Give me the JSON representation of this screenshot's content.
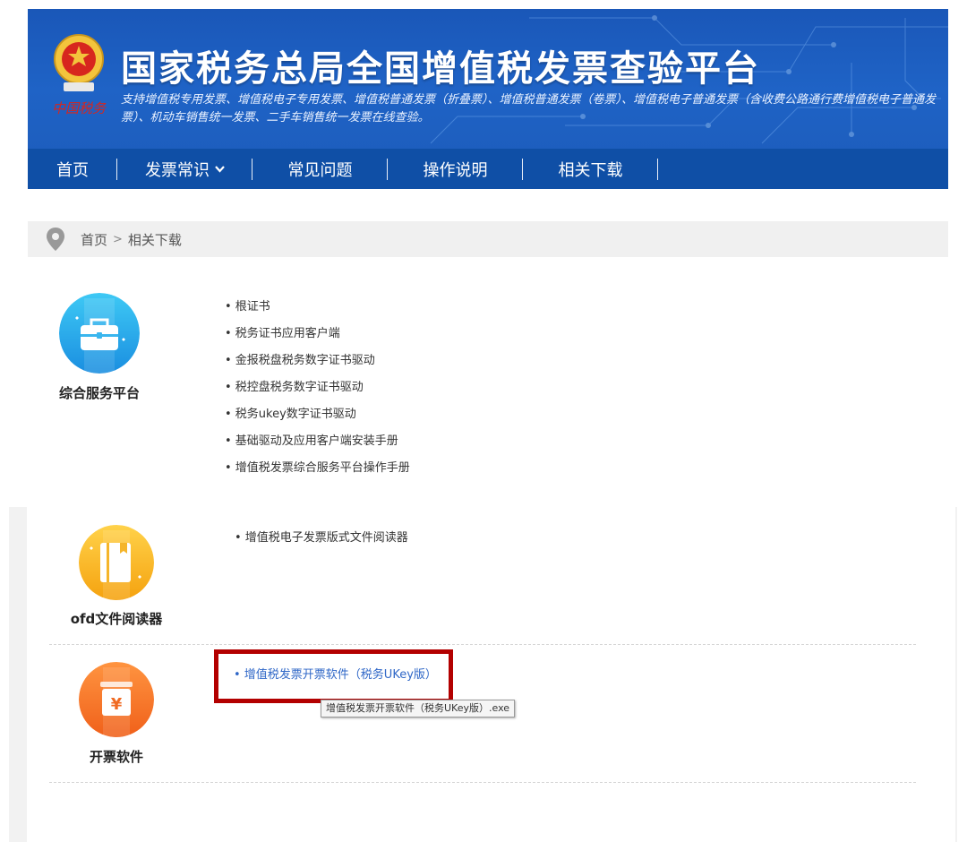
{
  "header": {
    "title": "国家税务总局全国增值税发票查验平台",
    "subtitle": "支持增值税专用发票、增值税电子专用发票、增值税普通发票（折叠票）、增值税普通发票（卷票）、增值税电子普通发票（含收费公路通行费增值税电子普通发票）、机动车销售统一发票、二手车销售统一发票在线查验。",
    "emblem_text": "中国税务",
    "brand_color": "#1a57b8"
  },
  "nav": {
    "items": [
      {
        "label": "首页"
      },
      {
        "label": "发票常识",
        "icon": "chevron-down-icon"
      },
      {
        "label": "常见问题"
      },
      {
        "label": "操作说明"
      },
      {
        "label": "相关下载"
      }
    ]
  },
  "breadcrumb": {
    "icon": "location-pin-icon",
    "home": "首页",
    "separator": ">",
    "current": "相关下载"
  },
  "sections": [
    {
      "title": "综合服务平台",
      "icon": "briefcase-icon",
      "links": [
        "• 根证书",
        "• 税务证书应用客户端",
        "• 金报税盘税务数字证书驱动",
        "• 税控盘税务数字证书驱动",
        "• 税务ukey数字证书驱动",
        "• 基础驱动及应用客户端安装手册",
        "• 增值税发票综合服务平台操作手册"
      ]
    },
    {
      "title": "ofd文件阅读器",
      "icon": "book-icon",
      "links": [
        "• 增值税电子发票版式文件阅读器"
      ]
    },
    {
      "title": "开票软件",
      "icon": "invoice-yen-icon",
      "links": [
        "• 增值税发票开票软件（税务UKey版）"
      ]
    }
  ],
  "tooltip": "增值税发票开票软件（税务UKey版）.exe",
  "colors": {
    "link_hover": "#2f67c7",
    "highlight_border": "#b30000"
  }
}
